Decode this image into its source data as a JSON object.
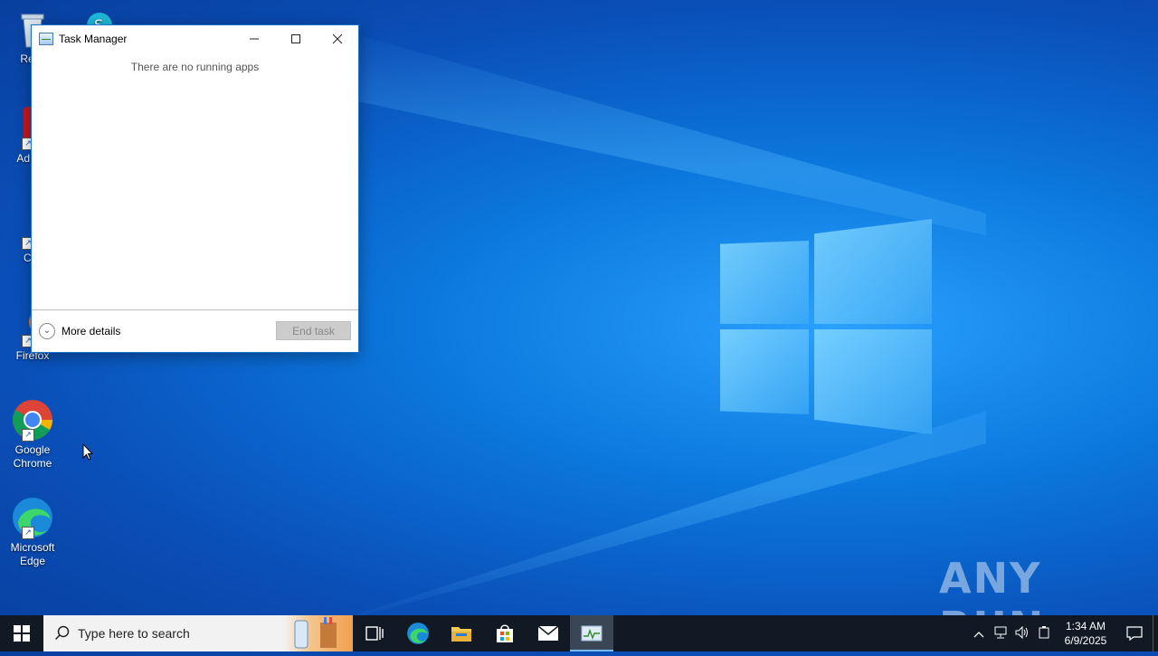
{
  "desktop": {
    "icons": [
      {
        "label": "Recy",
        "icon": "recycle-bin-icon"
      },
      {
        "label": "Ad Acr",
        "icon": "adobe-acrobat-icon"
      },
      {
        "label": "CCl",
        "icon": "ccleaner-icon"
      },
      {
        "label": "Firefox",
        "icon": "firefox-icon"
      },
      {
        "label": "Google Chrome",
        "icon": "chrome-icon"
      },
      {
        "label": "Microsoft Edge",
        "icon": "edge-icon"
      }
    ],
    "watermark": "ANY RUN"
  },
  "task_manager": {
    "title": "Task Manager",
    "empty_message": "There are no running apps",
    "more_details_label": "More details",
    "end_task_label": "End task",
    "controls": {
      "minimize": "—",
      "maximize": "☐",
      "close": "✕"
    }
  },
  "taskbar": {
    "search_placeholder": "Type here to search",
    "pinned": [
      "start-icon",
      "task-view-icon",
      "edge-icon",
      "file-explorer-icon",
      "store-icon",
      "mail-icon",
      "task-manager-icon"
    ],
    "clock": {
      "time": "1:34 AM",
      "date": "6/9/2025"
    }
  },
  "colors": {
    "taskbar": "#111a24",
    "window_border": "#1a73c8",
    "accent": "#76b9ed"
  }
}
